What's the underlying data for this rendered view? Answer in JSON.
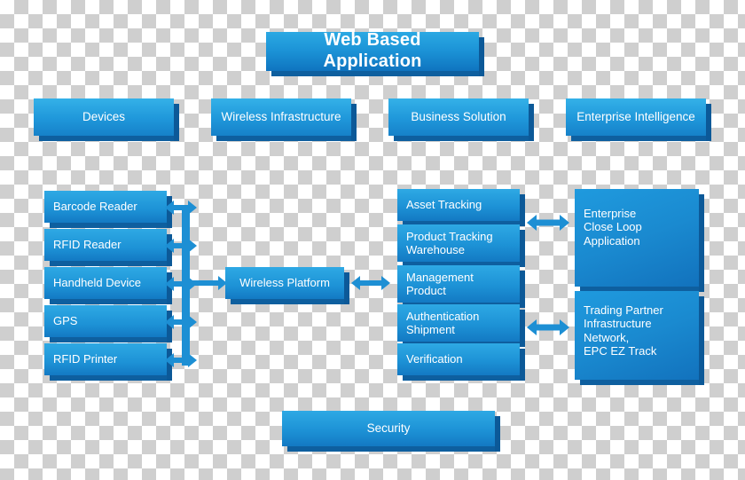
{
  "diagram": {
    "title": "Web Based Application",
    "tier2": [
      {
        "label": "Devices"
      },
      {
        "label": "Wireless Infrastructure"
      },
      {
        "label": "Business Solution"
      },
      {
        "label": "Enterprise Intelligence"
      }
    ],
    "devices_column": [
      {
        "label": "Barcode Reader"
      },
      {
        "label": "RFID Reader"
      },
      {
        "label": "Handheld Device"
      },
      {
        "label": "GPS"
      },
      {
        "label": "RFID Printer"
      }
    ],
    "platform": {
      "label": "Wireless Platform"
    },
    "solutions_column": [
      {
        "label": "Asset Tracking"
      },
      {
        "label": "Product Tracking\nWarehouse"
      },
      {
        "label": "Management\nProduct"
      },
      {
        "label": "Authentication\nShipment"
      },
      {
        "label": "Verification"
      }
    ],
    "intelligence_boxes": [
      {
        "label": "Enterprise\nClose Loop\nApplication"
      },
      {
        "label": "Trading Partner\nInfrastructure\nNetwork,\nEPC EZ Track"
      }
    ],
    "security": {
      "label": "Security"
    },
    "colors": {
      "node_light": "#2ea9e4",
      "node_mid": "#1d92d6",
      "node_dark": "#1379c3",
      "extrude": "#0e5f9f",
      "arrow": "#1d8fd4",
      "text": "#ffffff"
    }
  }
}
